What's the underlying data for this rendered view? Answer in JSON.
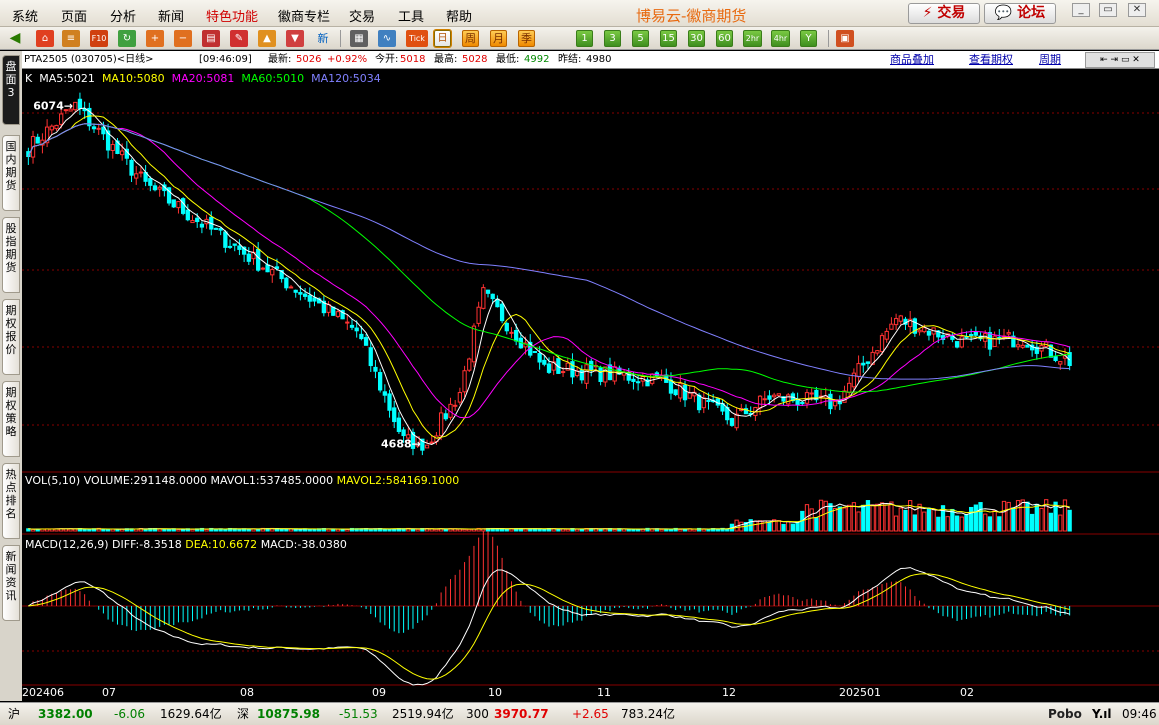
{
  "menu": {
    "items": [
      "系统",
      "页面",
      "分析",
      "新闻",
      "特色功能",
      "徽商专栏",
      "交易",
      "工具",
      "帮助"
    ],
    "brand": "博易云-徽商期货",
    "trade_button": "⚡ 交易",
    "forum_button": "💬 论坛"
  },
  "window_controls": [
    "_",
    "▭",
    "✕"
  ],
  "toolbar": {
    "icons": [
      "back-icon",
      "home-icon",
      "list-icon",
      "f10-icon",
      "refresh-icon",
      "zoom-in-icon",
      "zoom-out-icon",
      "layout-icon",
      "draw-icon",
      "alert-icon",
      "filter-icon",
      "new-icon"
    ],
    "f10_label": "F10",
    "new_label": "新",
    "tick_label": "Tick",
    "periods": [
      "日",
      "周",
      "月",
      "季",
      "1",
      "3",
      "5",
      "15",
      "30",
      "60",
      "2hr",
      "4hr",
      "Y"
    ]
  },
  "left_tabs": [
    "盘面3",
    "国内期货",
    "股指期货",
    "期权报价",
    "期权策略",
    "热点排名",
    "新闻资讯"
  ],
  "info": {
    "symbol": "PTA2505 (030705)<日线>",
    "time": "[09:46:09]",
    "latest_label": "最新:",
    "latest": "5026",
    "change": "+0.92%",
    "open_label": "今开:",
    "open": "5018",
    "high_label": "最高:",
    "high": "5028",
    "low_label": "最低:",
    "low": "4992",
    "prev_label": "昨结:",
    "prev": "4980",
    "links": [
      "商品叠加",
      "查看期权",
      "周期"
    ]
  },
  "ma_legend": {
    "k": "K",
    "ma5": "MA5:5021",
    "ma10": "MA10:5080",
    "ma20": "MA20:5081",
    "ma60": "MA60:5010",
    "ma120": "MA120:5034"
  },
  "colors": {
    "up": "#ff3232",
    "down": "#00ffff",
    "ma5": "#ffffff",
    "ma10": "#ffff00",
    "ma20": "#ff00ff",
    "ma60": "#00ff00",
    "ma120": "#8080ff",
    "grid": "#880000"
  },
  "annotations": {
    "high": "6074",
    "low": "4688"
  },
  "vol_legend": {
    "title": "VOL(5,10)",
    "volume": "VOLUME:291148.0000",
    "mavol1": "MAVOL1:537485.0000",
    "mavol2": "MAVOL2:584169.1000"
  },
  "macd_legend": {
    "title": "MACD(12,26,9)",
    "diff": "DIFF:-8.3518",
    "dea": "DEA:10.6672",
    "macd": "MACD:-38.0380"
  },
  "x_labels": [
    "202406",
    "07",
    "08",
    "09",
    "10",
    "11",
    "12",
    "202501",
    "02"
  ],
  "chart_data": {
    "type": "candlestick",
    "price_anchor_points": [
      {
        "t": 0,
        "price": 5900
      },
      {
        "t": 10,
        "price": 6074
      },
      {
        "t": 25,
        "price": 5750
      },
      {
        "t": 55,
        "price": 5350
      },
      {
        "t": 70,
        "price": 5150
      },
      {
        "t": 80,
        "price": 4700
      },
      {
        "t": 85,
        "price": 4688
      },
      {
        "t": 92,
        "price": 4900
      },
      {
        "t": 97,
        "price": 5300
      },
      {
        "t": 110,
        "price": 5000
      },
      {
        "t": 135,
        "price": 4950
      },
      {
        "t": 150,
        "price": 4780
      },
      {
        "t": 158,
        "price": 4880
      },
      {
        "t": 172,
        "price": 4850
      },
      {
        "t": 185,
        "price": 5200
      },
      {
        "t": 200,
        "price": 5100
      },
      {
        "t": 212,
        "price": 5120
      },
      {
        "t": 222,
        "price": 5026
      }
    ],
    "price_range": [
      4600,
      6150
    ],
    "volume_max": 1600000,
    "macd_range": [
      -120,
      120
    ]
  },
  "status": {
    "sh_label": "沪",
    "sh_value": "3382.00",
    "sh_change": "-6.06",
    "sh_amount": "1629.64亿",
    "sz_label": "深",
    "sz_value": "10875.98",
    "sz_change": "-51.53",
    "sz_amount": "2519.94亿",
    "cy_label": "300",
    "cy_value": "3970.77",
    "cy_change": "+2.65",
    "cy_amount": "783.24亿",
    "pobo": "Pobo",
    "signal": "Y.ıl",
    "clock": "09:46"
  }
}
